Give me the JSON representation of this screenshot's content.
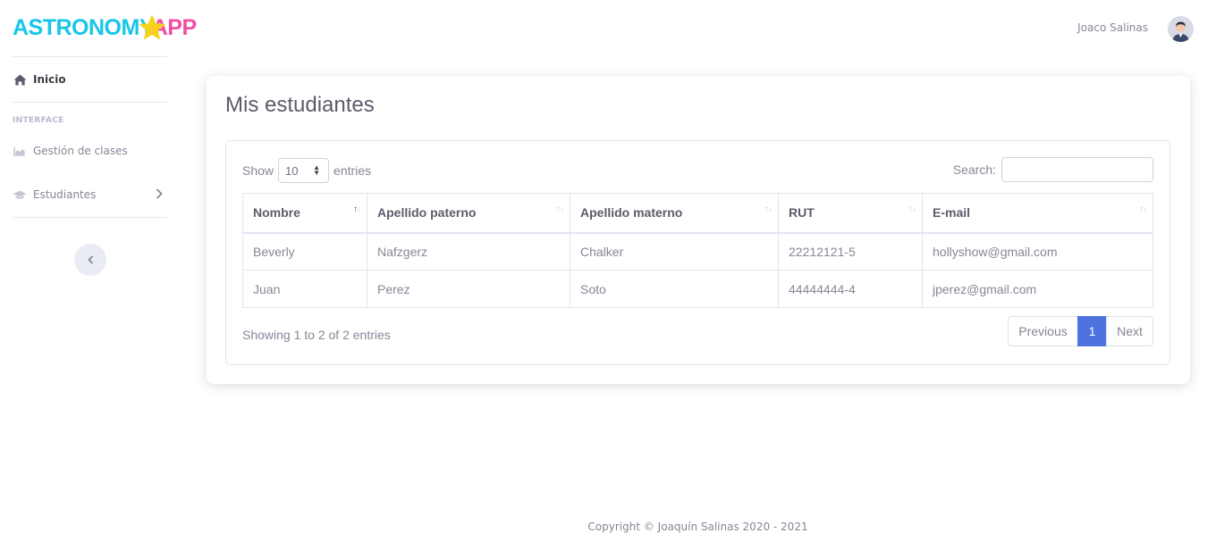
{
  "brand": {
    "part1": "ASTRONOMY",
    "part2": "APP"
  },
  "sidebar": {
    "home_label": "Inicio",
    "heading": "INTERFACE",
    "items": [
      {
        "label": "Gestión de clases",
        "icon": "chart-area-icon"
      },
      {
        "label": "Estudiantes",
        "icon": "graduation-cap-icon"
      }
    ]
  },
  "topbar": {
    "user_name": "Joaco Salinas"
  },
  "page": {
    "title": "Mis estudiantes"
  },
  "table_controls": {
    "show_label": "Show",
    "entries_value": "10",
    "entries_label": "entries",
    "search_label": "Search:",
    "search_value": ""
  },
  "table": {
    "columns": [
      "Nombre",
      "Apellido paterno",
      "Apellido materno",
      "RUT",
      "E-mail"
    ],
    "rows": [
      [
        "Beverly",
        "Nafzgerz",
        "Chalker",
        "22212121-5",
        "hollyshow@gmail.com"
      ],
      [
        "Juan",
        "Perez",
        "Soto",
        "44444444-4",
        "jperez@gmail.com"
      ]
    ]
  },
  "pagination": {
    "info": "Showing 1 to 2 of 2 entries",
    "previous": "Previous",
    "current": "1",
    "next": "Next"
  },
  "footer": {
    "text": "Copyright © Joaquín Salinas 2020 - 2021"
  },
  "colors": {
    "primary": "#4e73df",
    "brand_cyan": "#17c6e9",
    "brand_pink": "#f24da2",
    "star": "#f6d21e"
  }
}
